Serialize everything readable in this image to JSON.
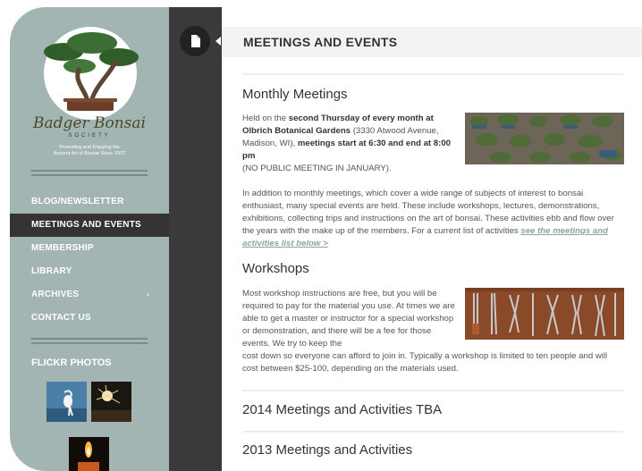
{
  "sidebar": {
    "logo": {
      "name": "Badger Bonsai",
      "sub": "SOCIETY",
      "tagline_1": "Promoting and Enjoying the",
      "tagline_2": "Ancient Art of Bonsai Since 1972"
    },
    "nav": [
      {
        "label": "BLOG/NEWSLETTER",
        "active": false
      },
      {
        "label": "MEETINGS AND EVENTS",
        "active": true
      },
      {
        "label": "MEMBERSHIP",
        "active": false
      },
      {
        "label": "LIBRARY",
        "active": false
      },
      {
        "label": "ARCHIVES",
        "active": false,
        "submenu_glyph": "›"
      },
      {
        "label": "CONTACT US",
        "active": false
      }
    ],
    "flickr_title": "FLICKR PHOTOS"
  },
  "header": {
    "title": "MEETINGS AND EVENTS",
    "page_icon": "page-icon"
  },
  "content": {
    "monthly": {
      "heading": "Monthly Meetings",
      "p1": {
        "t1": "Held on the ",
        "b1": "second Thursday of every month at",
        "b2": "Olbrich Botanical Gardens",
        "t2": " (3330 Atwood Avenue, Madison, WI), ",
        "b3": "meetings start at 6:30 and end at 8:00 pm",
        "t3": "(NO PUBLIC MEETING IN  JANUARY)."
      },
      "p2": "In addition to monthly meetings, which cover a wide range of subjects of interest to bonsai enthusiast, many special events are held. These include workshops, lectures, demonstrations, exhibitions, collecting trips and instructions on the art of bonsai. These activities ebb and flow over the years with the make up of the members. For a current list of activities ",
      "link": "see the meetings and activities list below >"
    },
    "workshops": {
      "heading": "Workshops",
      "p1": "Most workshop instructions are free, but you will be required to pay for the material you use. At times we are able to get a master or instructor for a special workshop or demonstration, and there will be a fee for those events. We try to keep the",
      "p2": "cost down so everyone can afford to join in. Typically a workshop is limited to ten people and will cost between $25-100, depending on the materials used."
    },
    "section_2014": "2014 Meetings and Activities TBA",
    "section_2013": "2013 Meetings and Activities"
  }
}
